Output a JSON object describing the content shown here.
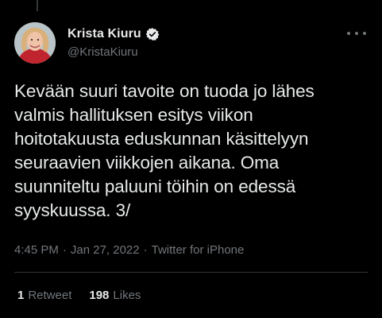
{
  "author": {
    "display_name": "Krista Kiuru",
    "handle": "@KristaKiuru",
    "verified": true,
    "verified_color": "#e7e9ea"
  },
  "tweet": {
    "text": "Kevään suuri tavoite on tuoda jo lähes\nvalmis hallituksen esitys viikon\nhoitotakuusta eduskunnan käsittelyyn\nseuraavien viikkojen aikana. Oma\nsuunniteltu paluuni töihin on edessä\nsyyskuussa. 3/",
    "time": "4:45 PM",
    "date": "Jan 27, 2022",
    "source": "Twitter for iPhone",
    "separator": "·"
  },
  "stats": {
    "retweets_count": "1",
    "retweets_label": "Retweet",
    "likes_count": "198",
    "likes_label": "Likes"
  },
  "colors": {
    "background": "#000000",
    "text_primary": "#e7e9ea",
    "text_secondary": "#71767b",
    "divider": "#2f3336"
  },
  "icons": {
    "verified": "verified-badge-icon",
    "more": "more-horizontal-icon"
  }
}
